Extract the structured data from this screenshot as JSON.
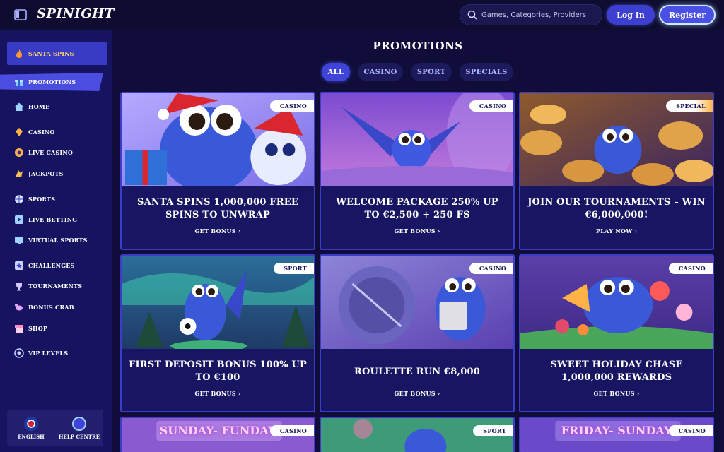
{
  "header": {
    "logo": "SPINIGHT",
    "search_placeholder": "Games, Categories, Providers",
    "login_label": "Log In",
    "register_label": "Register"
  },
  "sidebar": {
    "items": [
      {
        "label": "SANTA SPINS",
        "icon": "flame-icon"
      },
      {
        "label": "PROMOTIONS",
        "icon": "gift-icon"
      },
      {
        "label": "HOME",
        "icon": "home-icon"
      },
      {
        "label": "CASINO",
        "icon": "casino-icon"
      },
      {
        "label": "LIVE CASINO",
        "icon": "live-casino-icon"
      },
      {
        "label": "JACKPOTS",
        "icon": "jackpot-icon"
      },
      {
        "label": "SPORTS",
        "icon": "basketball-icon"
      },
      {
        "label": "LIVE BETTING",
        "icon": "play-icon"
      },
      {
        "label": "VIRTUAL SPORTS",
        "icon": "virtual-sports-icon"
      },
      {
        "label": "CHALLENGES",
        "icon": "star-icon"
      },
      {
        "label": "TOURNAMENTS",
        "icon": "trophy-icon"
      },
      {
        "label": "BONUS CRAB",
        "icon": "crab-icon"
      },
      {
        "label": "SHOP",
        "icon": "shop-icon"
      },
      {
        "label": "VIP LEVELS",
        "icon": "vip-icon"
      }
    ],
    "footer": {
      "language_label": "ENGLISH",
      "help_label": "HELP CENTRE"
    }
  },
  "main": {
    "title": "PROMOTIONS",
    "filters": [
      "ALL",
      "CASINO",
      "SPORT",
      "SPECIALS"
    ],
    "cards": [
      {
        "tag": "CASINO",
        "title": "SANTA SPINS 1,000,000 FREE SPINS TO UNWRAP",
        "cta": "GET BONUS"
      },
      {
        "tag": "CASINO",
        "title": "WELCOME PACKAGE 250% UP TO €2,500 + 250 FS",
        "cta": "GET BONUS"
      },
      {
        "tag": "SPECIAL",
        "title": "JOIN OUR TOURNAMENTS – WIN €6,000,000!",
        "cta": "PLAY NOW"
      },
      {
        "tag": "SPORT",
        "title": "FIRST DEPOSIT BONUS 100% UP TO €100",
        "cta": "GET BONUS"
      },
      {
        "tag": "CASINO",
        "title": "ROULETTE RUN €8,000",
        "cta": "GET BONUS"
      },
      {
        "tag": "CASINO",
        "title": "SWEET HOLIDAY CHASE 1,000,000 REWARDS",
        "cta": "GET BONUS"
      },
      {
        "tag": "CASINO",
        "banner": "SUNDAY- FUNDAY"
      },
      {
        "tag": "SPORT",
        "banner": ""
      },
      {
        "tag": "CASINO",
        "banner": "FRIDAY- SUNDAY"
      }
    ]
  },
  "colors": {
    "background": "#100d3a",
    "sidebar": "#161460",
    "accent": "#3f43d8",
    "card_border": "#3b3dc8"
  }
}
